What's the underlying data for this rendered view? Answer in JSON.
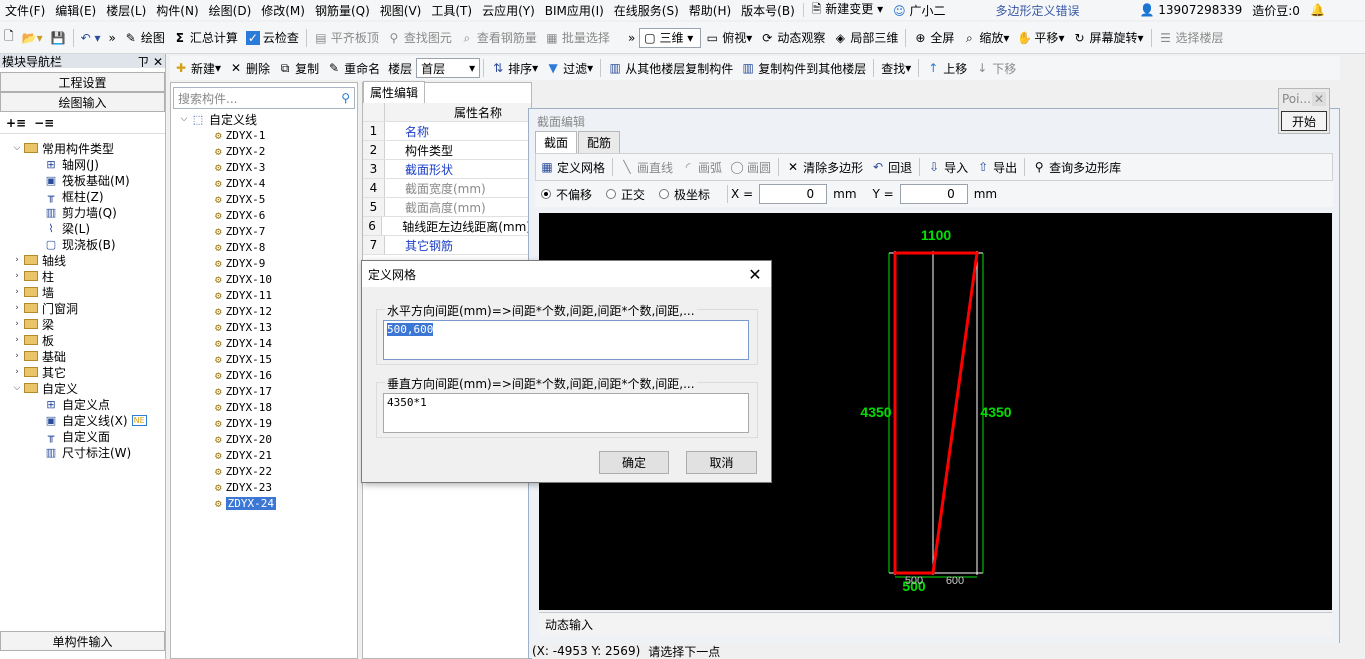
{
  "menubar": {
    "items": [
      "文件(F)",
      "编辑(E)",
      "楼层(L)",
      "构件(N)",
      "绘图(D)",
      "修改(M)",
      "钢筋量(Q)",
      "视图(V)",
      "工具(T)",
      "云应用(Y)",
      "BIM应用(I)",
      "在线服务(S)",
      "帮助(H)",
      "版本号(B)"
    ],
    "new_change": "新建变更",
    "assistant": "广小二",
    "center_title": "多边形定义错误",
    "phone": "13907298339",
    "price_bean": "造价豆:0"
  },
  "toolbar": {
    "draw": "绘图",
    "sum_calc": "汇总计算",
    "cloud_check": "云检查",
    "align_slab": "平齐板顶",
    "find_element": "查找图元",
    "view_rebar": "查看钢筋量",
    "batch_select": "批量选择",
    "view_3d": "三维",
    "top_view": "俯视",
    "dynamic_observe": "动态观察",
    "local_3d": "局部三维",
    "fullscreen": "全屏",
    "zoom": "缩放",
    "pan": "平移",
    "screen_rotate": "屏幕旋转",
    "select_floor": "选择楼层"
  },
  "toolbar2": {
    "new": "新建",
    "delete": "删除",
    "copy": "复制",
    "rename": "重命名",
    "floor_label": "楼层",
    "floor_value": "首层",
    "sort": "排序",
    "filter": "过滤",
    "copy_from_other": "从其他楼层复制构件",
    "copy_to_other": "复制构件到其他楼层",
    "find": "查找",
    "move_up": "上移",
    "move_down": "下移"
  },
  "nav": {
    "title": "模块导航栏",
    "pin": "ㄗ",
    "close": "✕",
    "project_settings": "工程设置",
    "drawing_input": "绘图输入",
    "single_input": "单构件输入",
    "tree": [
      {
        "label": "常用构件类型",
        "level": 0,
        "expanded": true,
        "folder": true
      },
      {
        "label": "轴网(J)",
        "level": 1
      },
      {
        "label": "筏板基础(M)",
        "level": 1
      },
      {
        "label": "框柱(Z)",
        "level": 1
      },
      {
        "label": "剪力墙(Q)",
        "level": 1
      },
      {
        "label": "梁(L)",
        "level": 1
      },
      {
        "label": "现浇板(B)",
        "level": 1
      },
      {
        "label": "轴线",
        "level": 0,
        "folder": true
      },
      {
        "label": "柱",
        "level": 0,
        "folder": true
      },
      {
        "label": "墙",
        "level": 0,
        "folder": true
      },
      {
        "label": "门窗洞",
        "level": 0,
        "folder": true
      },
      {
        "label": "梁",
        "level": 0,
        "folder": true
      },
      {
        "label": "板",
        "level": 0,
        "folder": true
      },
      {
        "label": "基础",
        "level": 0,
        "folder": true
      },
      {
        "label": "其它",
        "level": 0,
        "folder": true
      },
      {
        "label": "自定义",
        "level": 0,
        "expanded": true,
        "folder": true
      },
      {
        "label": "自定义点",
        "level": 1
      },
      {
        "label": "自定义线(X)",
        "level": 1,
        "badge": "NE"
      },
      {
        "label": "自定义面",
        "level": 1
      },
      {
        "label": "尺寸标注(W)",
        "level": 1
      }
    ]
  },
  "components": {
    "search_placeholder": "搜索构件...",
    "root": "自定义线",
    "items": [
      "ZDYX-1",
      "ZDYX-2",
      "ZDYX-3",
      "ZDYX-4",
      "ZDYX-5",
      "ZDYX-6",
      "ZDYX-7",
      "ZDYX-8",
      "ZDYX-9",
      "ZDYX-10",
      "ZDYX-11",
      "ZDYX-12",
      "ZDYX-13",
      "ZDYX-14",
      "ZDYX-15",
      "ZDYX-16",
      "ZDYX-17",
      "ZDYX-18",
      "ZDYX-19",
      "ZDYX-20",
      "ZDYX-21",
      "ZDYX-22",
      "ZDYX-23",
      "ZDYX-24"
    ],
    "selected": "ZDYX-24"
  },
  "props": {
    "tab": "属性编辑",
    "header": "属性名称",
    "rows": [
      {
        "num": "1",
        "name": "名称",
        "style": "blue"
      },
      {
        "num": "2",
        "name": "构件类型",
        "style": "normal"
      },
      {
        "num": "3",
        "name": "截面形状",
        "style": "blue"
      },
      {
        "num": "4",
        "name": "截面宽度(mm)",
        "style": "gray"
      },
      {
        "num": "5",
        "name": "截面高度(mm)",
        "style": "gray"
      },
      {
        "num": "6",
        "name": "轴线距左边线距离(mm)",
        "style": "normal"
      },
      {
        "num": "7",
        "name": "其它钢筋",
        "style": "blue"
      }
    ]
  },
  "section": {
    "title": "截面编辑",
    "tabs": [
      "截面",
      "配筋"
    ],
    "tools": {
      "define_grid": "定义网格",
      "draw_line": "画直线",
      "draw_arc": "画弧",
      "draw_circle": "画圆",
      "clear_polygon": "清除多边形",
      "undo": "回退",
      "import": "导入",
      "export": "导出",
      "query_library": "查询多边形库"
    },
    "opts": {
      "no_offset": "不偏移",
      "orthogonal": "正交",
      "polar": "极坐标",
      "x_label": "X =",
      "x_value": "0",
      "y_label": "Y =",
      "y_value": "0",
      "unit": "mm"
    },
    "dims": {
      "top": "1100",
      "left": "4350",
      "right": "4350",
      "bottom_green": "500",
      "bottom_grid_1": "500",
      "bottom_grid_2": "600"
    },
    "dynamic_input": "动态输入",
    "coords": "(X: -4953 Y: 2569)",
    "status": "请选择下一点"
  },
  "poi": {
    "title": "Poi...",
    "start": "开始"
  },
  "dialog": {
    "title": "定义网格",
    "h_label": "水平方向间距(mm)=>间距*个数,间距,间距*个数,间距,...",
    "h_value": "500,600",
    "v_label": "垂直方向间距(mm)=>间距*个数,间距,间距*个数,间距,...",
    "v_value": "4350*1",
    "ok": "确定",
    "cancel": "取消"
  },
  "colors": {
    "polygon": "#ff0000",
    "dimension": "#00e000",
    "grid": "#ffffff",
    "canvas": "#000000"
  }
}
